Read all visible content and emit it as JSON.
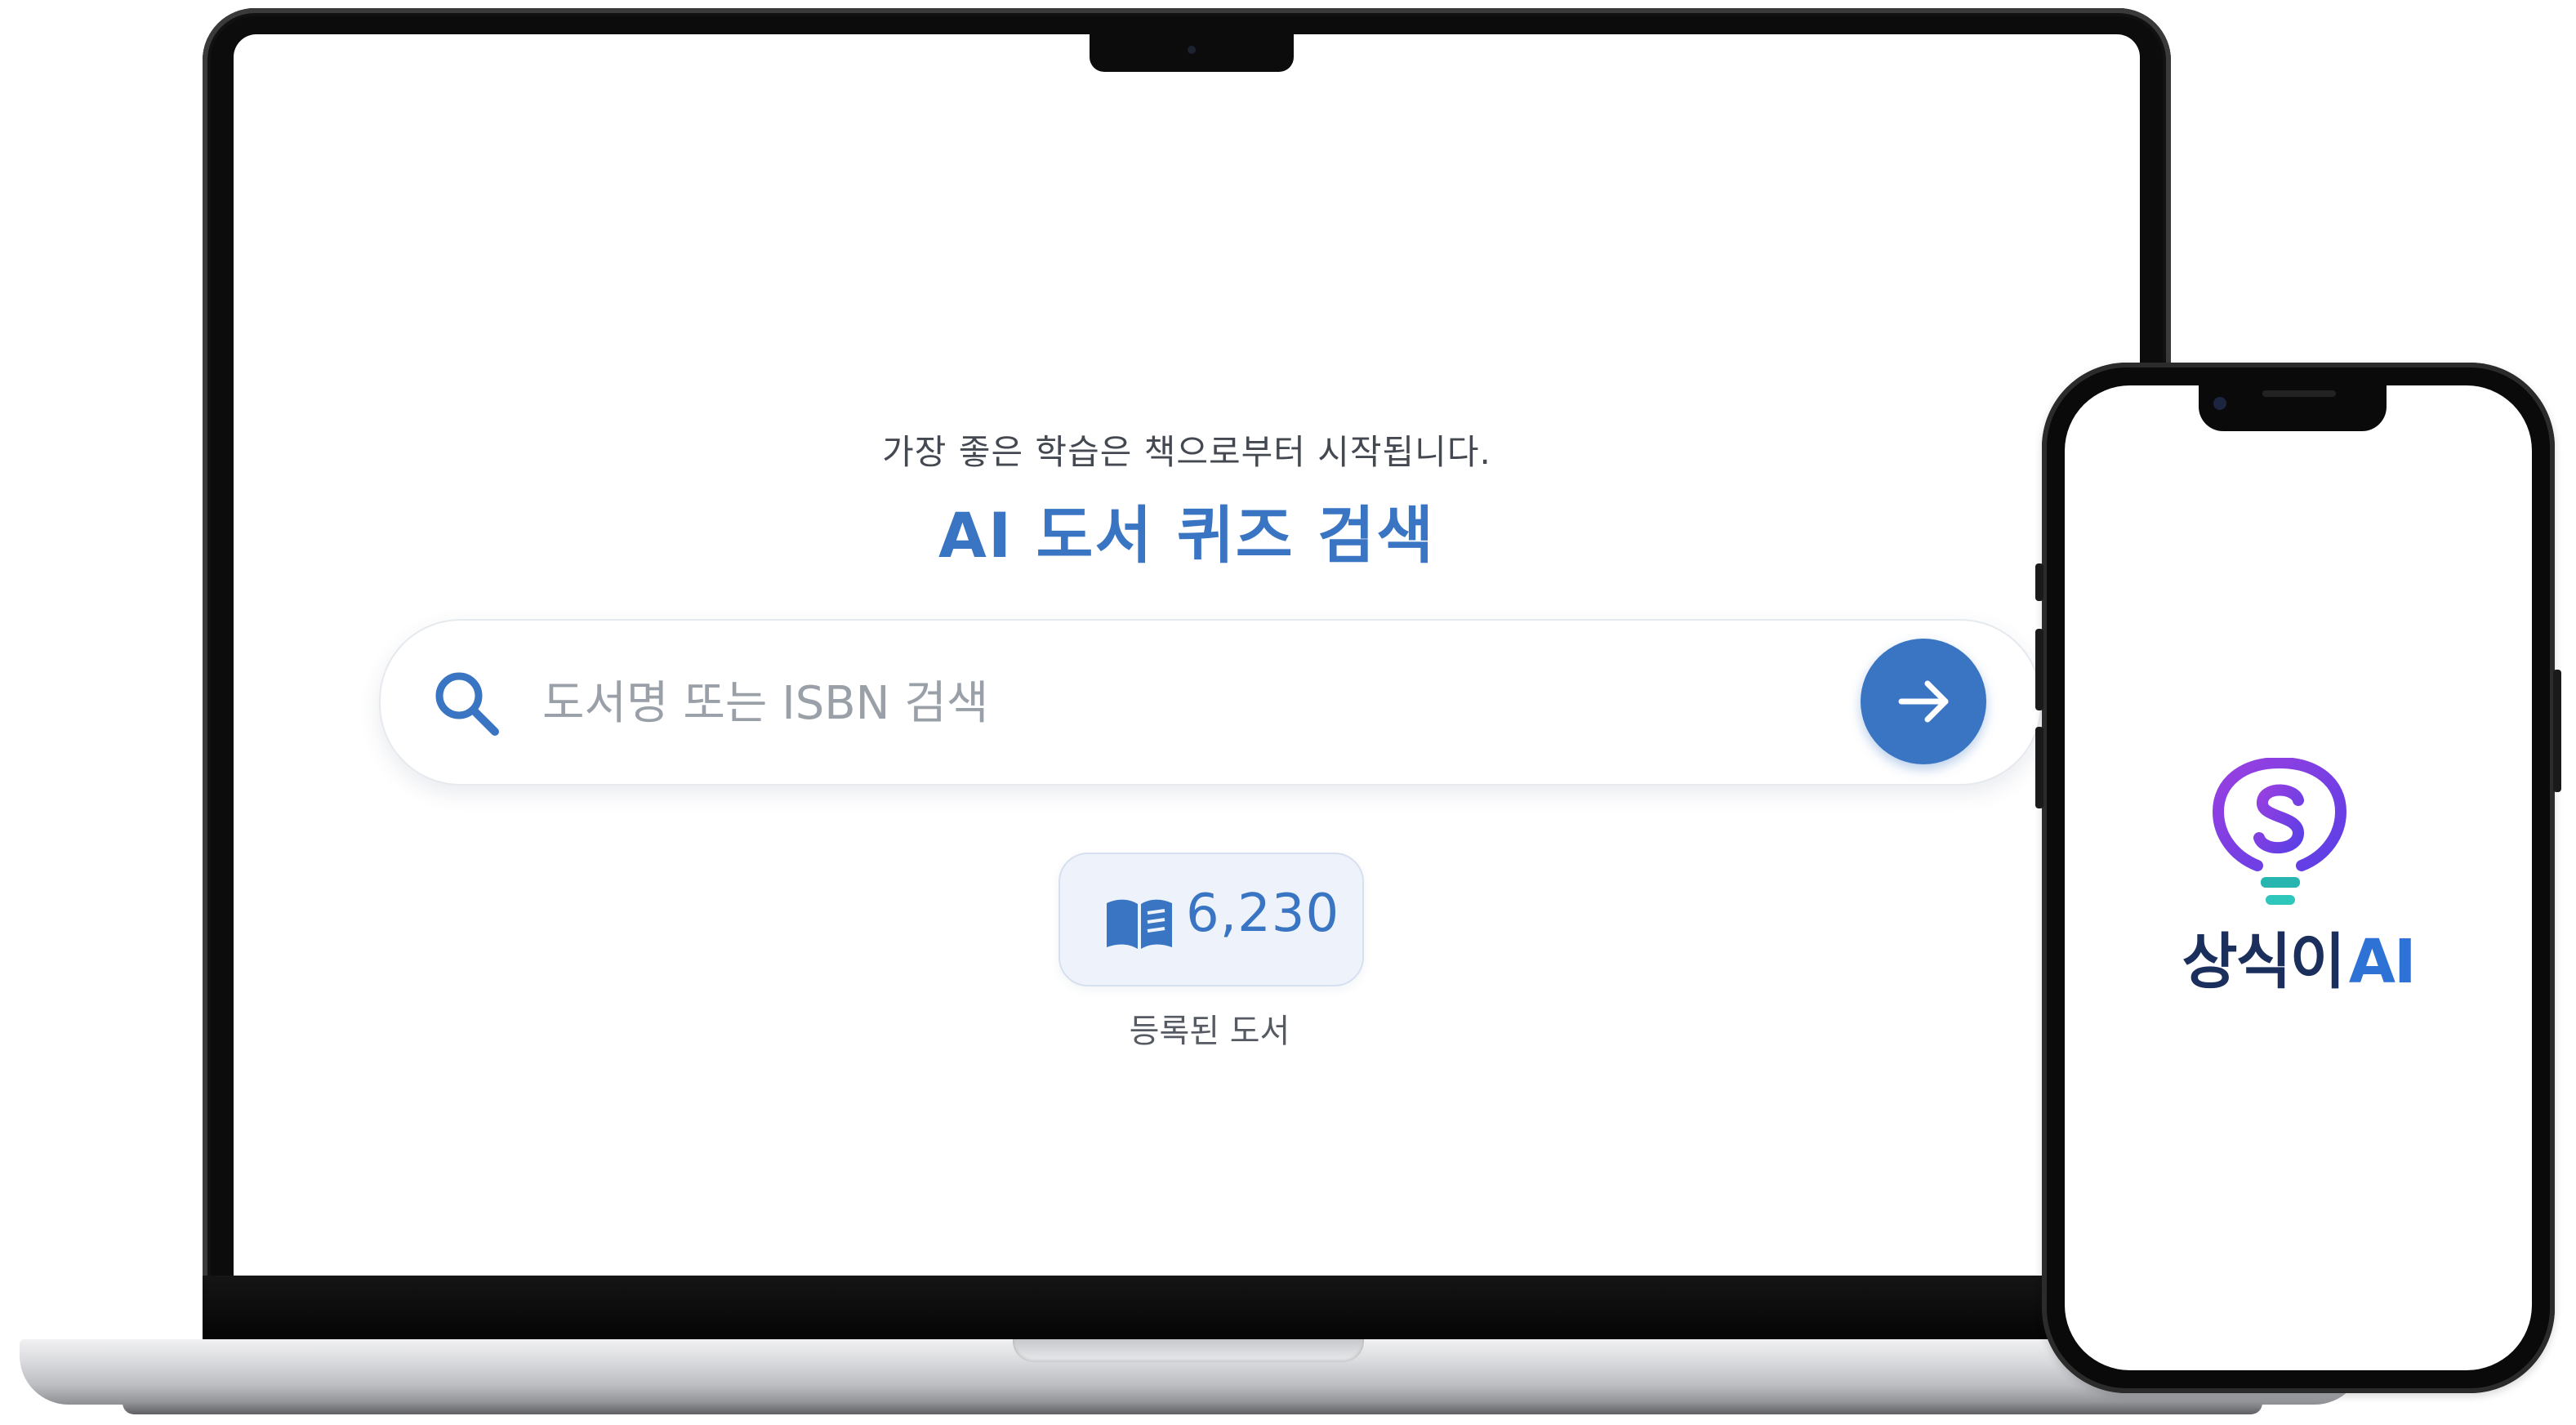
{
  "search_page": {
    "tagline": "가장 좋은 학습은 책으로부터 시작됩니다.",
    "title": "AI 도서 퀴즈 검색",
    "search": {
      "placeholder": "도서명 또는 ISBN 검색",
      "value": "",
      "search_icon": "search-icon",
      "submit_icon": "arrow-right-icon"
    },
    "stats": {
      "icon": "book-open-icon",
      "count": "6,230",
      "caption": "등록된 도서"
    }
  },
  "phone_splash": {
    "brand_ko": "상식이",
    "brand_ai": "AI",
    "logo_icon": "lightbulb-s-logo"
  },
  "colors": {
    "accent": "#3a75c4",
    "brand_navy": "#1b2f5c",
    "brand_blue": "#2f72d6",
    "logo_purple": "#7b3fe4",
    "logo_teal": "#27b5b0",
    "badge_bg": "#eef3fb"
  }
}
